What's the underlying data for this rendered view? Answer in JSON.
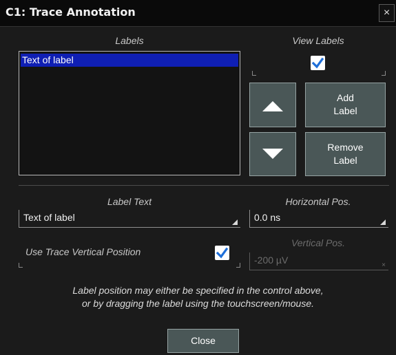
{
  "window": {
    "title": "C1: Trace Annotation",
    "close_glyph": "×"
  },
  "labels_panel": {
    "caption": "Labels",
    "items": [
      {
        "text": "Text of label",
        "selected": true
      }
    ]
  },
  "view_labels": {
    "caption": "View Labels",
    "checked": true
  },
  "buttons": {
    "add_label_line1": "Add",
    "add_label_line2": "Label",
    "remove_label_line1": "Remove",
    "remove_label_line2": "Label",
    "up_icon": "triangle-up-icon",
    "down_icon": "triangle-down-icon",
    "close": "Close"
  },
  "label_text": {
    "caption": "Label Text",
    "value": "Text of label"
  },
  "horizontal_pos": {
    "caption": "Horizontal Pos.",
    "value": "0.0 ns"
  },
  "use_trace_vertical": {
    "caption": "Use Trace Vertical Position",
    "checked": true
  },
  "vertical_pos": {
    "caption": "Vertical Pos.",
    "value": "-200 µV",
    "disabled": true
  },
  "note": {
    "line1": "Label position may either be specified in the control above,",
    "line2": "or by dragging the label using the touchscreen/mouse."
  },
  "colors": {
    "selection": "#0f1fb4",
    "button_face": "#4a5757",
    "checkbox_check": "#1e6fd9"
  }
}
